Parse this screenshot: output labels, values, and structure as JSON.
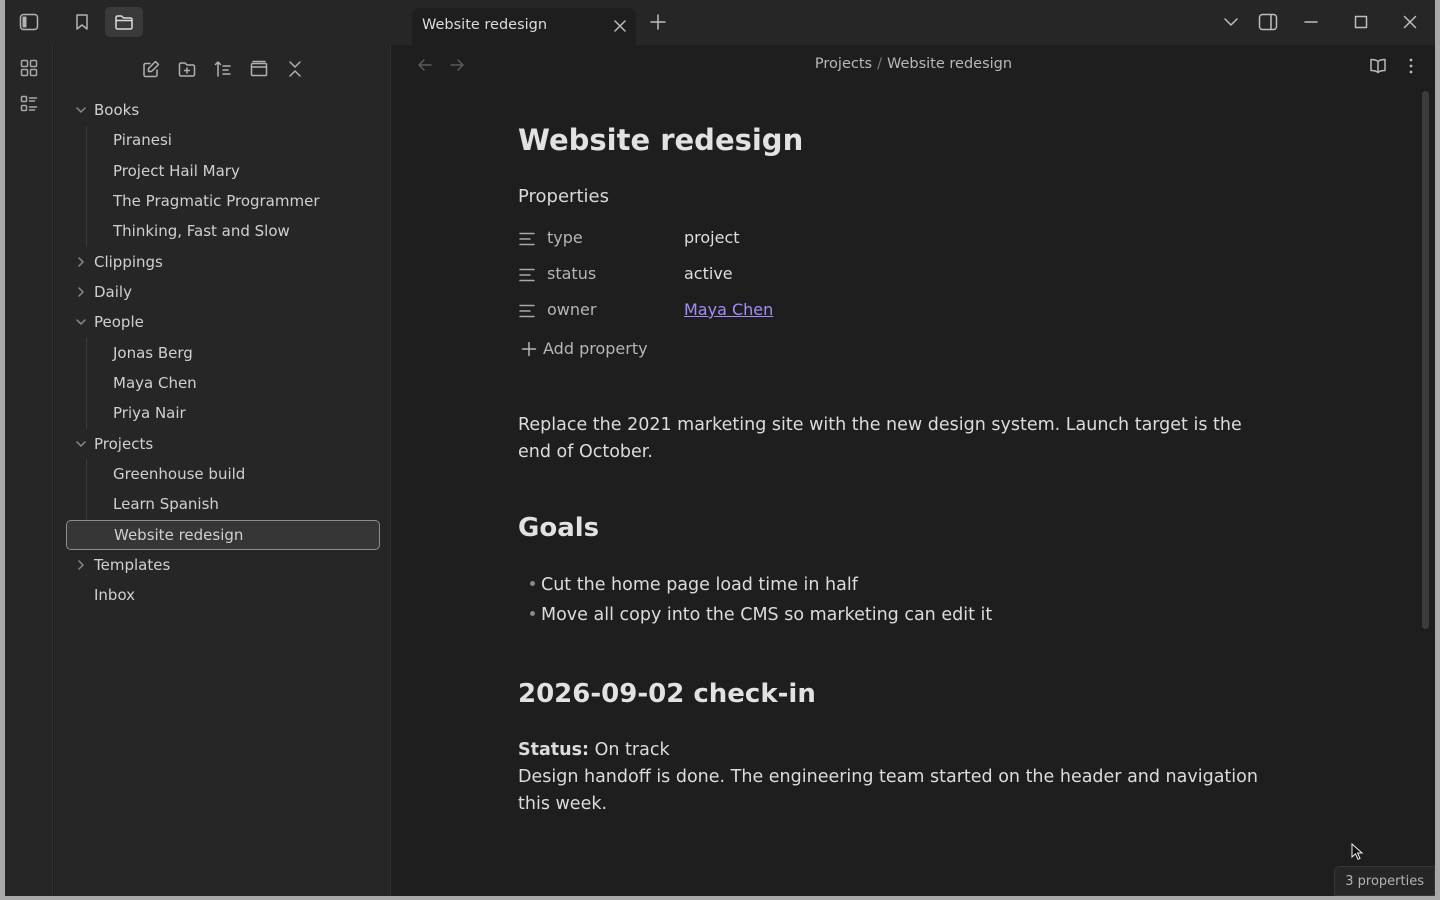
{
  "tab": {
    "title": "Website redesign"
  },
  "breadcrumb": {
    "parent": "Projects",
    "separator": "/",
    "current": "Website redesign"
  },
  "sidebar": {
    "tree": [
      {
        "label": "Books",
        "type": "folder",
        "expanded": true
      },
      {
        "label": "Piranesi",
        "type": "file"
      },
      {
        "label": "Project Hail Mary",
        "type": "file"
      },
      {
        "label": "The Pragmatic Programmer",
        "type": "file"
      },
      {
        "label": "Thinking, Fast and Slow",
        "type": "file"
      },
      {
        "label": "Clippings",
        "type": "folder",
        "expanded": false
      },
      {
        "label": "Daily",
        "type": "folder",
        "expanded": false
      },
      {
        "label": "People",
        "type": "folder",
        "expanded": true
      },
      {
        "label": "Jonas Berg",
        "type": "file"
      },
      {
        "label": "Maya Chen",
        "type": "file"
      },
      {
        "label": "Priya Nair",
        "type": "file"
      },
      {
        "label": "Projects",
        "type": "folder",
        "expanded": true
      },
      {
        "label": "Greenhouse build",
        "type": "file"
      },
      {
        "label": "Learn Spanish",
        "type": "file"
      },
      {
        "label": "Website redesign",
        "type": "file",
        "selected": true
      },
      {
        "label": "Templates",
        "type": "folder",
        "expanded": false
      },
      {
        "label": "Inbox",
        "type": "file"
      }
    ]
  },
  "note": {
    "title": "Website redesign",
    "properties_heading": "Properties",
    "properties": [
      {
        "key": "type",
        "value": "project"
      },
      {
        "key": "status",
        "value": "active"
      },
      {
        "key": "owner",
        "value": "Maya Chen",
        "link": true
      }
    ],
    "add_property": "Add property",
    "intro": "Replace the 2021 marketing site with the new design system. Launch target is the end of October.",
    "goals_heading": "Goals",
    "goals": [
      "Cut the home page load time in half",
      "Move all copy into the CMS so marketing can edit it"
    ],
    "checkin_heading": "2026-09-02 check-in",
    "checkin_status_label": "Status:",
    "checkin_status_value": "On track",
    "checkin_text": "Design handoff is done. The engineering team started on the header and navigation this week."
  },
  "status_bar": {
    "properties_count": "3 properties"
  },
  "colors": {
    "background": "#1e1e1e",
    "sidebar": "#262626",
    "link": "#a88bfa"
  }
}
